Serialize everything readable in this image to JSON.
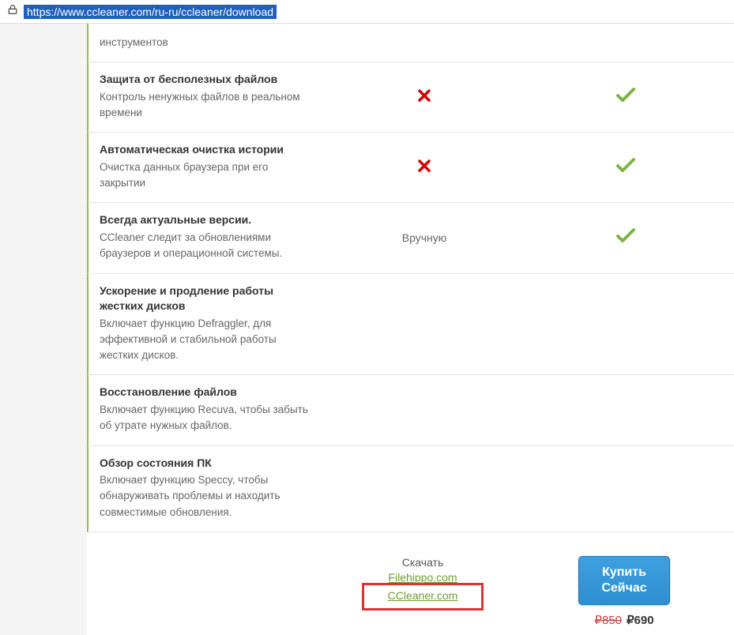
{
  "url": "https://www.ccleaner.com/ru-ru/ccleaner/download",
  "rows": [
    {
      "title": "",
      "desc": "инструментов",
      "col2": "",
      "col3": ""
    },
    {
      "title": "Защита от бесполезных файлов",
      "desc": "Контроль ненужных файлов в реальном времени",
      "col2": "x",
      "col3": "check"
    },
    {
      "title": "Автоматическая очистка истории",
      "desc": "Очистка данных браузера при его закрытии",
      "col2": "x",
      "col3": "check"
    },
    {
      "title": "Всегда актуальные версии.",
      "desc": "CCleaner следит за обновлениями браузеров и операционной системы.",
      "col2": "manual",
      "col3": "check"
    },
    {
      "title": "Ускорение и продление работы жестких дисков",
      "desc": "Включает функцию Defraggler, для эффективной и стабильной работы жестких дисков.",
      "col2": "",
      "col3": ""
    },
    {
      "title": "Восстановление файлов",
      "desc": "Включает функцию Recuva, чтобы забыть об утрате нужных файлов.",
      "col2": "",
      "col3": ""
    },
    {
      "title": "Обзор состояния ПК",
      "desc": "Включает функцию Speccy, чтобы обнаруживать проблемы и находить совместимые обновления.",
      "col2": "",
      "col3": ""
    }
  ],
  "manual_text": "Вручную",
  "download": {
    "label": "Скачать",
    "link1": "Filehippo.com",
    "link2": "CCleaner.com"
  },
  "buy": {
    "line1": "Купить",
    "line2": "Сейчас",
    "price_old": "₽850",
    "price_new": "₽690"
  }
}
